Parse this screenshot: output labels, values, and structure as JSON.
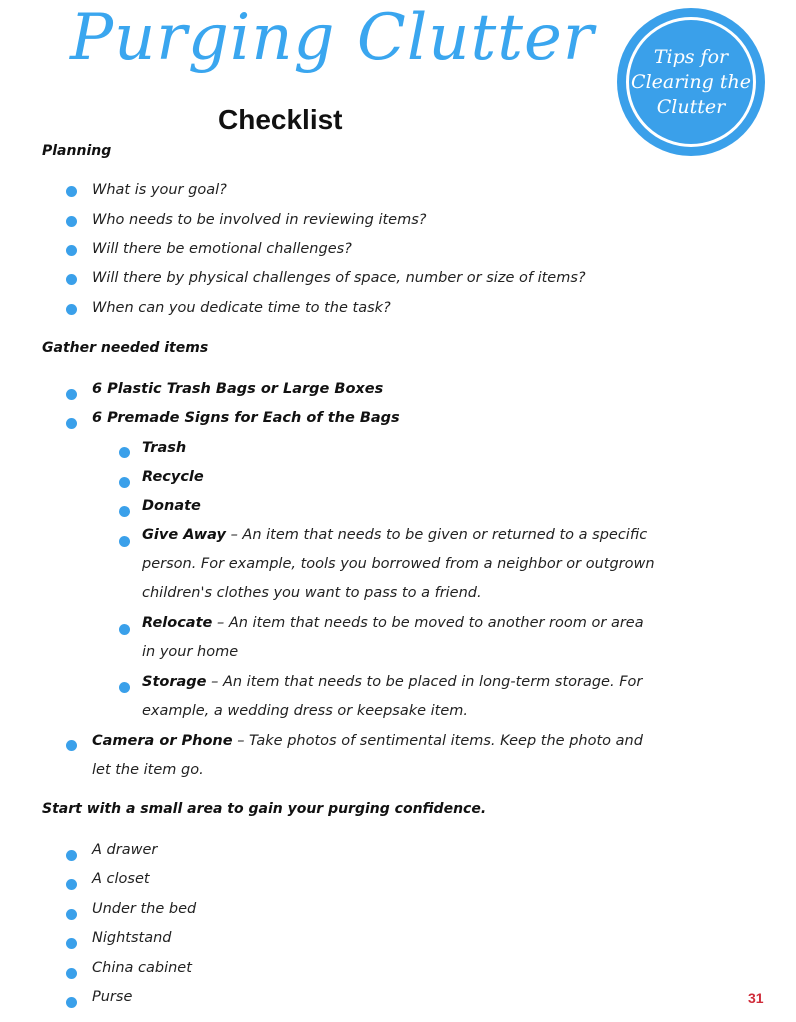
{
  "header": {
    "title": "Purging Clutter",
    "subtitle": "Checklist",
    "badge_line1": "Tips for",
    "badge_line2": "Clearing the",
    "badge_line3": "Clutter"
  },
  "sections": {
    "planning": {
      "heading": "Planning",
      "items": [
        "What is your goal?",
        "Who needs to be involved in reviewing items?",
        "Will there be emotional challenges?",
        "Will there by physical challenges of space, number or size of items?",
        "When can you dedicate time to the task?"
      ]
    },
    "gather": {
      "heading": "Gather needed items",
      "items": [
        "6 Plastic Trash Bags or Large Boxes",
        "6 Premade Signs for Each of the Bags"
      ],
      "signs": [
        {
          "label": "Trash",
          "desc": ""
        },
        {
          "label": "Recycle",
          "desc": ""
        },
        {
          "label": "Donate",
          "desc": ""
        },
        {
          "label": "Give Away",
          "desc": " – An item that needs to be given or returned to a specific",
          "desc2": "person. For example, tools you borrowed from a neighbor or outgrown",
          "desc3": "children's clothes you want to pass to a friend."
        },
        {
          "label": "Relocate",
          "desc": " – An item that needs to be moved to another room or area",
          "desc2": "in your home"
        },
        {
          "label": "Storage",
          "desc": " – An item that needs to be placed in long-term storage. For",
          "desc2": "example, a wedding dress or keepsake item."
        }
      ],
      "camera": {
        "label": "Camera or Phone",
        "desc": " – Take photos of sentimental items. Keep the photo and",
        "desc2": "let the item go."
      }
    },
    "start": {
      "heading": "Start with a small area to gain your purging confidence.",
      "items": [
        "A drawer",
        "A closet",
        "Under the bed",
        "Nightstand",
        "China cabinet",
        "Purse"
      ]
    }
  },
  "footer": {
    "logo_text": "31"
  }
}
